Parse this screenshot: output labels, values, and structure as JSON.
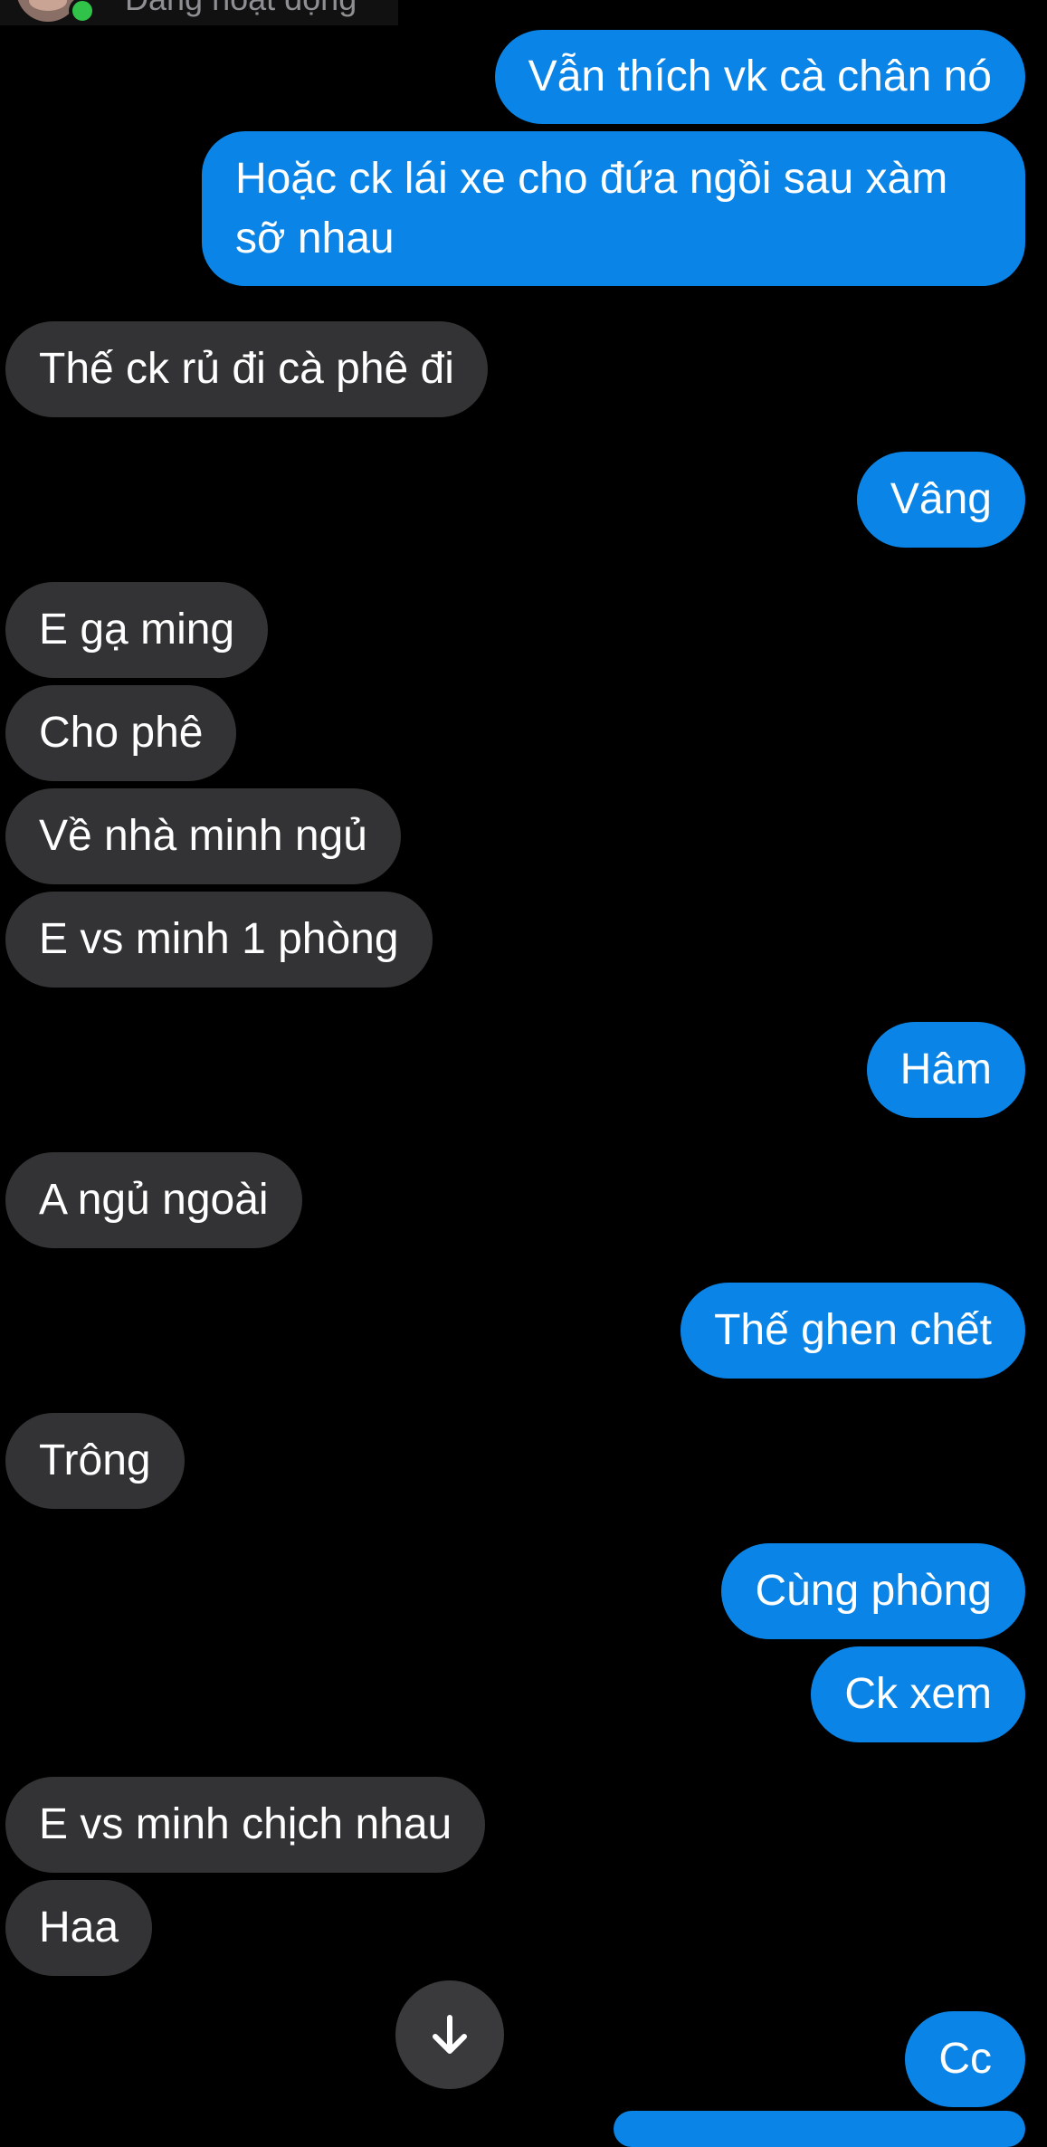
{
  "header": {
    "status": "Đang hoạt động"
  },
  "messages": [
    {
      "side": "sent",
      "text": "Vẫn thích vk cà chân nó"
    },
    {
      "side": "sent",
      "text": "Hoặc ck lái xe cho đứa ngồi sau xàm sỡ nhau"
    },
    {
      "side": "recv",
      "text": "Thế ck rủ đi cà phê đi"
    },
    {
      "side": "sent",
      "text": "Vâng"
    },
    {
      "side": "recv",
      "text": "E gạ ming"
    },
    {
      "side": "recv",
      "text": "Cho phê"
    },
    {
      "side": "recv",
      "text": "Về nhà minh ngủ"
    },
    {
      "side": "recv",
      "text": "E vs minh 1 phòng"
    },
    {
      "side": "sent",
      "text": "Hâm"
    },
    {
      "side": "recv",
      "text": "A ngủ ngoài"
    },
    {
      "side": "sent",
      "text": "Thế ghen chết"
    },
    {
      "side": "recv",
      "text": "Trông"
    },
    {
      "side": "sent",
      "text": "Cùng phòng"
    },
    {
      "side": "sent",
      "text": "Ck xem"
    },
    {
      "side": "recv",
      "text": "E vs minh chịch nhau"
    },
    {
      "side": "recv",
      "text": "Haa"
    },
    {
      "side": "sent",
      "text": "Cc"
    }
  ],
  "icons": {
    "scroll": "arrow-down-icon",
    "presence": "online-dot-icon"
  },
  "colors": {
    "sent_bubble": "#0a84e6",
    "recv_bubble": "#333335",
    "background": "#000000"
  }
}
